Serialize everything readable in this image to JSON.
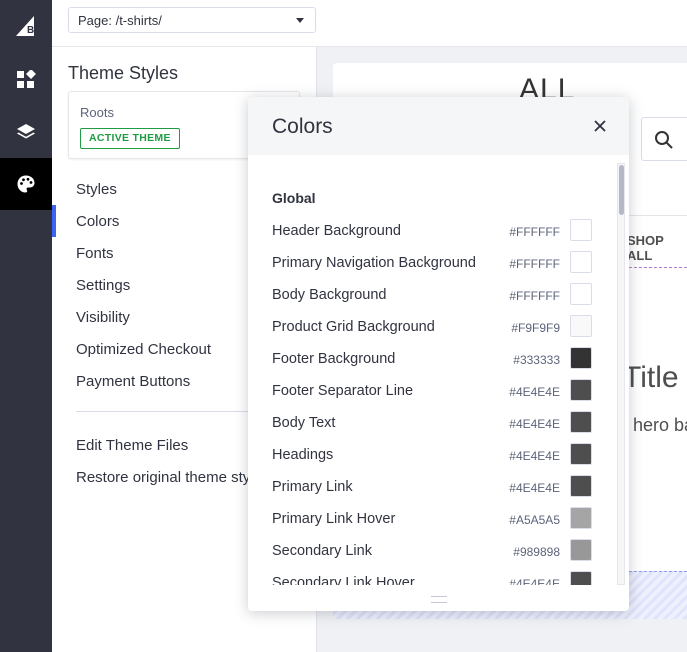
{
  "rail": {
    "items": [
      {
        "icon": "bigcommerce-logo-icon"
      },
      {
        "icon": "widgets-icon"
      },
      {
        "icon": "layers-icon"
      },
      {
        "icon": "palette-icon",
        "active": true
      }
    ]
  },
  "topbar": {
    "page_select_value": "Page: /t-shirts/"
  },
  "panel": {
    "title": "Theme Styles",
    "theme_name": "Roots",
    "theme_badge": "ACTIVE THEME",
    "nav": [
      "Styles",
      "Colors",
      "Fonts",
      "Settings",
      "Visibility",
      "Optimized Checkout",
      "Payment Buttons"
    ],
    "active_nav": "Colors",
    "secondary_nav": [
      "Edit Theme Files",
      "Restore original theme sty"
    ]
  },
  "preview": {
    "heading": "ALL",
    "shop_all": "SHOP ALL",
    "title_fragment": "Title",
    "subtitle_fragment": "hero ba"
  },
  "colors_popover": {
    "title": "Colors",
    "section": "Global",
    "items": [
      {
        "name": "Header Background",
        "hex": "#FFFFFF"
      },
      {
        "name": "Primary Navigation Background",
        "hex": "#FFFFFF"
      },
      {
        "name": "Body Background",
        "hex": "#FFFFFF"
      },
      {
        "name": "Product Grid Background",
        "hex": "#F9F9F9"
      },
      {
        "name": "Footer Background",
        "hex": "#333333"
      },
      {
        "name": "Footer Separator Line",
        "hex": "#4E4E4E"
      },
      {
        "name": "Body Text",
        "hex": "#4E4E4E"
      },
      {
        "name": "Headings",
        "hex": "#4E4E4E"
      },
      {
        "name": "Primary Link",
        "hex": "#4E4E4E"
      },
      {
        "name": "Primary Link Hover",
        "hex": "#A5A5A5"
      },
      {
        "name": "Secondary Link",
        "hex": "#989898"
      },
      {
        "name": "Secondary Link Hover",
        "hex": "#4E4E4E"
      }
    ]
  },
  "accent_colors": {
    "rail_bg": "#313440",
    "active_blue": "#3C64F4",
    "badge_green": "#1F9C43"
  }
}
